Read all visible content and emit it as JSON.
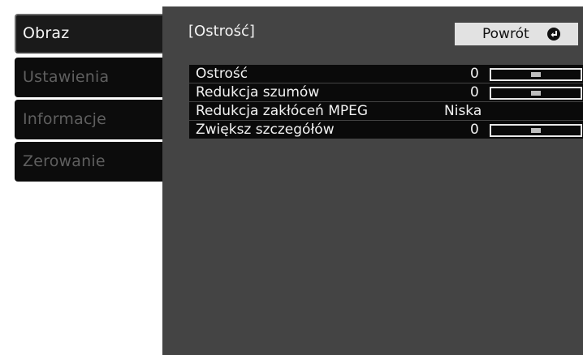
{
  "menu": {
    "items": [
      {
        "label": "Obraz",
        "active": true
      },
      {
        "label": "Ustawienia",
        "active": false
      },
      {
        "label": "Informacje",
        "active": false
      },
      {
        "label": "Zerowanie",
        "active": false
      }
    ]
  },
  "panel": {
    "title": "[Ostrość]",
    "back_label": "Powrót",
    "back_icon": "return-arrow-icon"
  },
  "settings": [
    {
      "label": "Ostrość",
      "value": "0",
      "slider_position": 0.5
    },
    {
      "label": "Redukcja szumów",
      "value": "0",
      "slider_position": 0.5
    },
    {
      "label": "Redukcja zakłóceń MPEG",
      "value": "Niska"
    },
    {
      "label": "Zwiększ szczegółów",
      "value": "0",
      "slider_position": 0.5
    }
  ],
  "colors": {
    "panel_bg": "#444444",
    "row_bg": "#0a0a0a",
    "back_button_bg": "#e2e2e2",
    "text": "#f2f2f2"
  }
}
